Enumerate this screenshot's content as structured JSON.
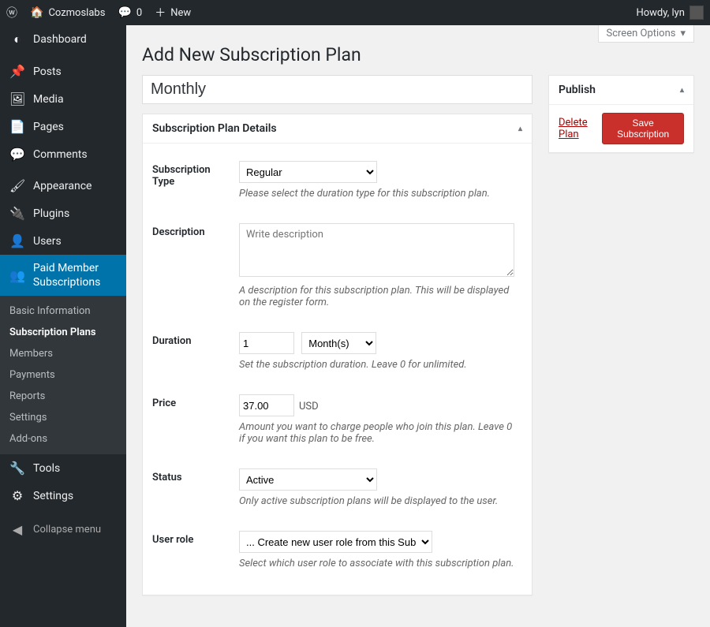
{
  "adminbar": {
    "site_name": "Cozmoslabs",
    "comments": "0",
    "new_label": "New",
    "howdy": "Howdy, lyn"
  },
  "sidebar": {
    "items": [
      {
        "label": "Dashboard",
        "icon": "◐"
      },
      {
        "label": "Posts",
        "icon": "📌"
      },
      {
        "label": "Media",
        "icon": "🖼"
      },
      {
        "label": "Pages",
        "icon": "📄"
      },
      {
        "label": "Comments",
        "icon": "💬"
      },
      {
        "label": "Appearance",
        "icon": "🖌"
      },
      {
        "label": "Plugins",
        "icon": "🔌"
      },
      {
        "label": "Users",
        "icon": "👤"
      },
      {
        "label": "Paid Member Subscriptions",
        "icon": "👥"
      },
      {
        "label": "Tools",
        "icon": "🔧"
      },
      {
        "label": "Settings",
        "icon": "⚙"
      }
    ],
    "sub": [
      "Basic Information",
      "Subscription Plans",
      "Members",
      "Payments",
      "Reports",
      "Settings",
      "Add-ons"
    ],
    "collapse": "Collapse menu"
  },
  "screen_options": "Screen Options",
  "page_title": "Add New Subscription Plan",
  "title_value": "Monthly",
  "details": {
    "heading": "Subscription Plan Details",
    "type_label": "Subscription Type",
    "type_value": "Regular",
    "type_desc": "Please select the duration type for this subscription plan.",
    "desc_label": "Description",
    "desc_placeholder": "Write description",
    "desc_desc": "A description for this subscription plan. This will be displayed on the register form.",
    "dur_label": "Duration",
    "dur_value": "1",
    "dur_unit": "Month(s)",
    "dur_desc": "Set the subscription duration. Leave 0 for unlimited.",
    "price_label": "Price",
    "price_value": "37.00",
    "price_currency": "USD",
    "price_desc": "Amount you want to charge people who join this plan. Leave 0 if you want this plan to be free.",
    "status_label": "Status",
    "status_value": "Active",
    "status_desc": "Only active subscription plans will be displayed to the user.",
    "role_label": "User role",
    "role_value": "... Create new user role from this Subscription Plan",
    "role_desc": "Select which user role to associate with this subscription plan."
  },
  "publish": {
    "heading": "Publish",
    "delete": "Delete Plan",
    "save": "Save Subscription"
  }
}
